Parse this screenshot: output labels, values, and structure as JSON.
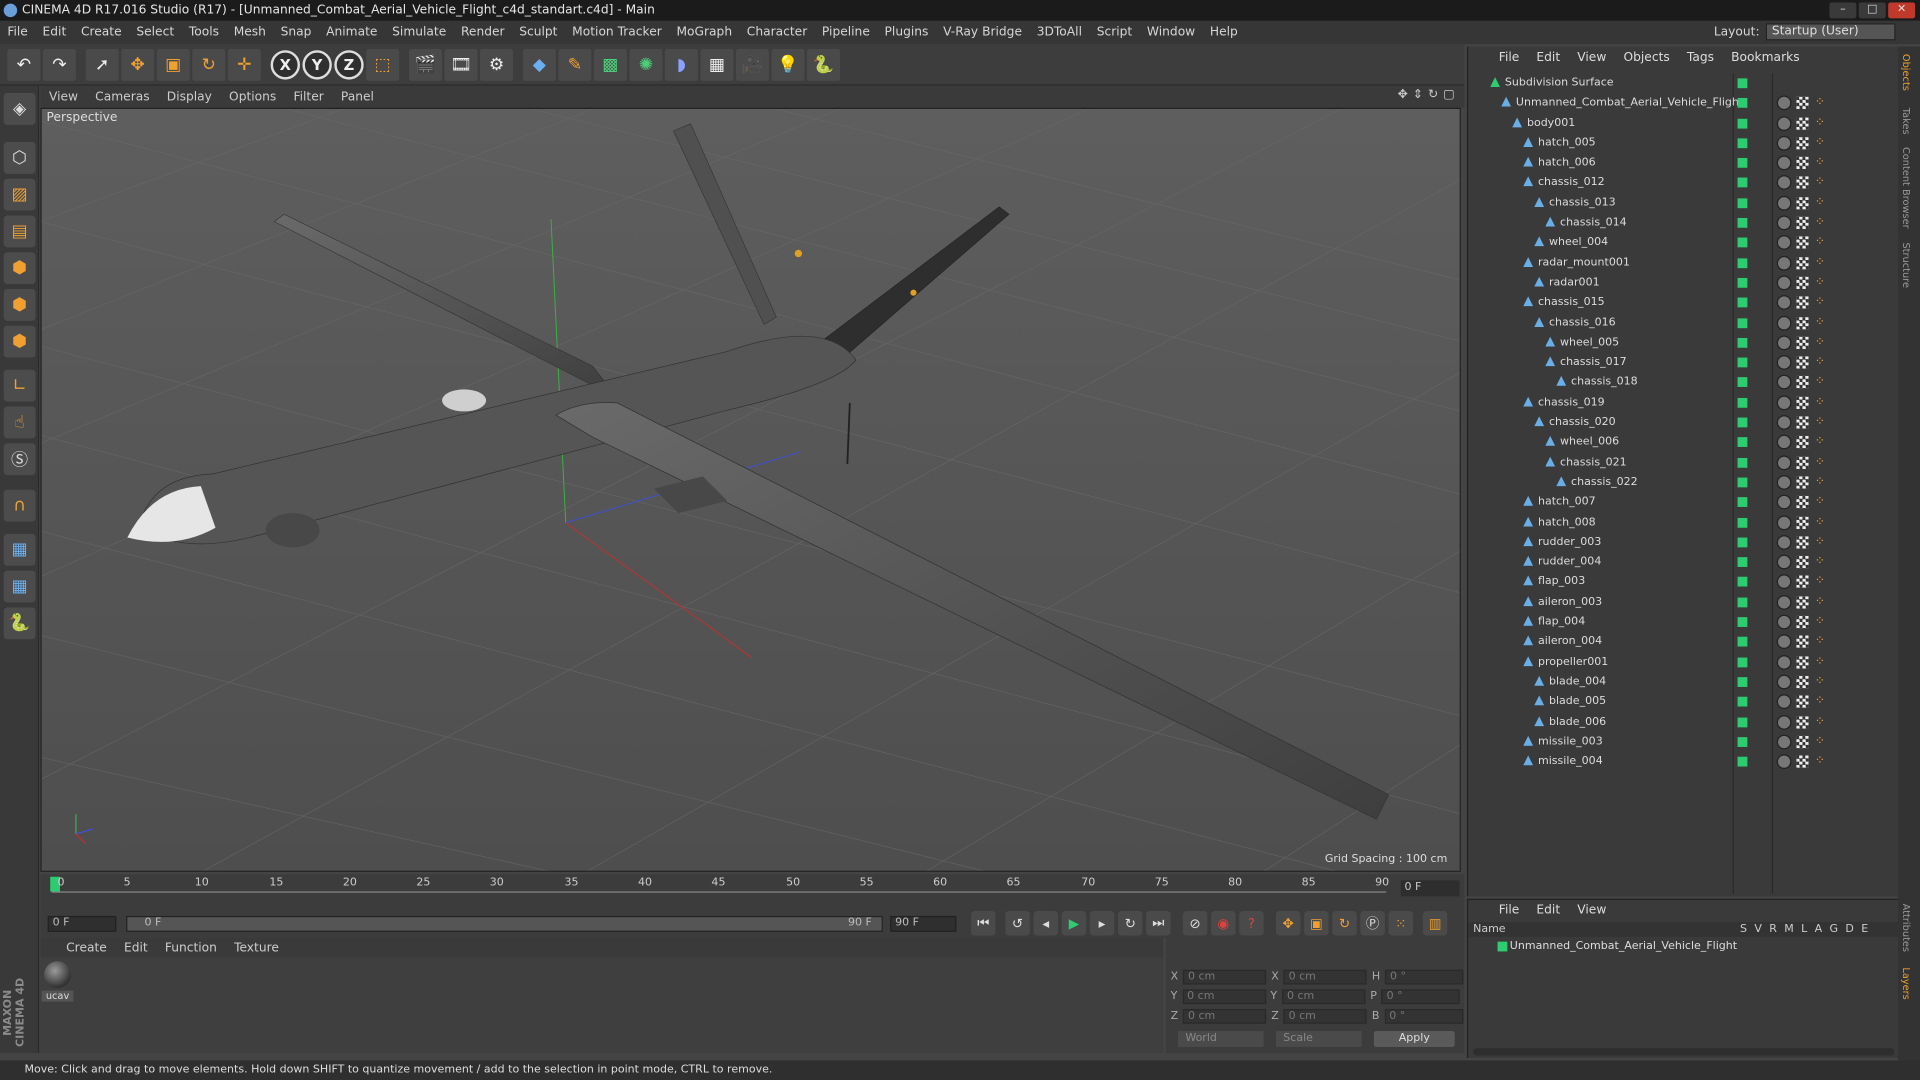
{
  "window": {
    "title": "CINEMA 4D R17.016 Studio (R17) - [Unmanned_Combat_Aerial_Vehicle_Flight_c4d_standart.c4d] - Main"
  },
  "menubar": {
    "items": [
      "File",
      "Edit",
      "Create",
      "Select",
      "Tools",
      "Mesh",
      "Snap",
      "Animate",
      "Simulate",
      "Render",
      "Sculpt",
      "Motion Tracker",
      "MoGraph",
      "Character",
      "Pipeline",
      "Plugins",
      "V-Ray Bridge",
      "3DToAll",
      "Script",
      "Window",
      "Help"
    ],
    "layout_label": "Layout:",
    "layout_value": "Startup (User)"
  },
  "toolbar": {
    "axis_x": "X",
    "axis_y": "Y",
    "axis_z": "Z"
  },
  "viewport": {
    "menu": [
      "View",
      "Cameras",
      "Display",
      "Options",
      "Filter",
      "Panel"
    ],
    "label": "Perspective",
    "grid_spacing": "Grid Spacing : 100 cm"
  },
  "timeline": {
    "ticks": [
      "0",
      "5",
      "10",
      "15",
      "20",
      "25",
      "30",
      "35",
      "40",
      "45",
      "50",
      "55",
      "60",
      "65",
      "70",
      "75",
      "80",
      "85",
      "90"
    ],
    "current_frame": "0 F"
  },
  "playbar": {
    "start": "0 F",
    "range_start": "0 F",
    "range_end": "90 F",
    "end": "90 F"
  },
  "material": {
    "menu": [
      "Create",
      "Edit",
      "Function",
      "Texture"
    ],
    "name": "ucav"
  },
  "coords": {
    "x": "X",
    "y": "Y",
    "z": "Z",
    "h": "H",
    "p": "P",
    "b": "B",
    "pos_x": "0 cm",
    "pos_y": "0 cm",
    "pos_z": "0 cm",
    "size_x": "0 cm",
    "size_y": "0 cm",
    "size_z": "0 cm",
    "rot_h": "0 °",
    "rot_p": "0 °",
    "rot_b": "0 °",
    "space": "World",
    "mode": "Scale",
    "apply": "Apply"
  },
  "objects": {
    "menu": [
      "File",
      "Edit",
      "View",
      "Objects",
      "Tags",
      "Bookmarks"
    ],
    "items": [
      {
        "name": "Subdivision Surface",
        "depth": 0
      },
      {
        "name": "Unmanned_Combat_Aerial_Vehicle_Flight",
        "depth": 1
      },
      {
        "name": "body001",
        "depth": 2
      },
      {
        "name": "hatch_005",
        "depth": 3
      },
      {
        "name": "hatch_006",
        "depth": 3
      },
      {
        "name": "chassis_012",
        "depth": 3
      },
      {
        "name": "chassis_013",
        "depth": 4
      },
      {
        "name": "chassis_014",
        "depth": 5
      },
      {
        "name": "wheel_004",
        "depth": 4
      },
      {
        "name": "radar_mount001",
        "depth": 3
      },
      {
        "name": "radar001",
        "depth": 4
      },
      {
        "name": "chassis_015",
        "depth": 3
      },
      {
        "name": "chassis_016",
        "depth": 4
      },
      {
        "name": "wheel_005",
        "depth": 5
      },
      {
        "name": "chassis_017",
        "depth": 5
      },
      {
        "name": "chassis_018",
        "depth": 6
      },
      {
        "name": "chassis_019",
        "depth": 3
      },
      {
        "name": "chassis_020",
        "depth": 4
      },
      {
        "name": "wheel_006",
        "depth": 5
      },
      {
        "name": "chassis_021",
        "depth": 5
      },
      {
        "name": "chassis_022",
        "depth": 6
      },
      {
        "name": "hatch_007",
        "depth": 3
      },
      {
        "name": "hatch_008",
        "depth": 3
      },
      {
        "name": "rudder_003",
        "depth": 3
      },
      {
        "name": "rudder_004",
        "depth": 3
      },
      {
        "name": "flap_003",
        "depth": 3
      },
      {
        "name": "aileron_003",
        "depth": 3
      },
      {
        "name": "flap_004",
        "depth": 3
      },
      {
        "name": "aileron_004",
        "depth": 3
      },
      {
        "name": "propeller001",
        "depth": 3
      },
      {
        "name": "blade_004",
        "depth": 4
      },
      {
        "name": "blade_005",
        "depth": 4
      },
      {
        "name": "blade_006",
        "depth": 4
      },
      {
        "name": "missile_003",
        "depth": 3
      },
      {
        "name": "missile_004",
        "depth": 3
      }
    ]
  },
  "layers": {
    "menu": [
      "File",
      "Edit",
      "View"
    ],
    "header_name": "Name",
    "columns": [
      "S",
      "V",
      "R",
      "M",
      "L",
      "A",
      "G",
      "D",
      "E"
    ],
    "row": "Unmanned_Combat_Aerial_Vehicle_Flight"
  },
  "side_tabs": [
    "Objects",
    "Takes",
    "Content Browser",
    "Structure",
    "Attributes",
    "Layers"
  ],
  "branding": "MAXON CINEMA 4D",
  "status": "Move: Click and drag to move elements. Hold down SHIFT to quantize movement / add to the selection in point mode, CTRL to remove.",
  "colors": {
    "accent_green": "#2ecc71",
    "tool_orange": "#f0a030",
    "viewport_bg": "#5a5a5a"
  }
}
